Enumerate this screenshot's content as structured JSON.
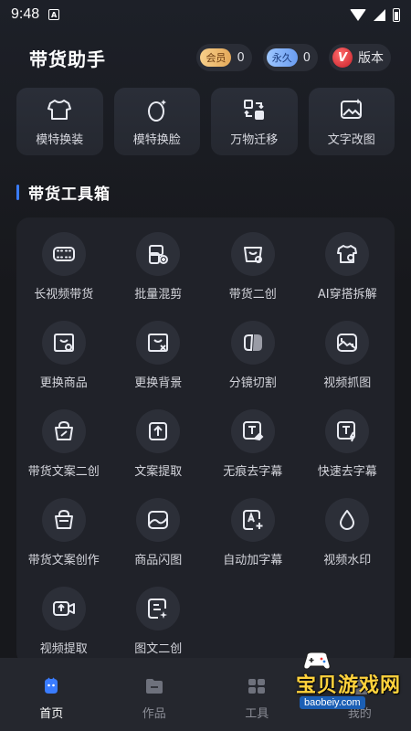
{
  "status_bar": {
    "time": "9:48",
    "notif_letter": "A"
  },
  "header": {
    "title": "带货助手",
    "vip_badge": "会员",
    "vip_count": "0",
    "forever_badge": "永久",
    "forever_count": "0",
    "version_badge": "V",
    "version_label": "版本"
  },
  "top_features": [
    {
      "label": "模特换装",
      "icon": "shirt-icon"
    },
    {
      "label": "模特换脸",
      "icon": "face-swap-icon"
    },
    {
      "label": "万物迁移",
      "icon": "transfer-icon"
    },
    {
      "label": "文字改图",
      "icon": "image-edit-icon"
    }
  ],
  "toolbox": {
    "title": "带货工具箱",
    "items": [
      {
        "label": "长视频带货",
        "icon": "film-strip-icon"
      },
      {
        "label": "批量混剪",
        "icon": "batch-clip-icon"
      },
      {
        "label": "带货二创",
        "icon": "shopping-bag-icon"
      },
      {
        "label": "AI穿搭拆解",
        "icon": "outfit-icon"
      },
      {
        "label": "更换商品",
        "icon": "swap-product-icon"
      },
      {
        "label": "更换背景",
        "icon": "background-icon"
      },
      {
        "label": "分镜切割",
        "icon": "scene-cut-icon"
      },
      {
        "label": "视频抓图",
        "icon": "video-capture-icon"
      },
      {
        "label": "带货文案二创",
        "icon": "copy-remix-icon"
      },
      {
        "label": "文案提取",
        "icon": "text-extract-icon"
      },
      {
        "label": "无痕去字幕",
        "icon": "subtitle-erase-icon"
      },
      {
        "label": "快速去字幕",
        "icon": "quick-subtitle-icon"
      },
      {
        "label": "带货文案创作",
        "icon": "copywrite-bag-icon"
      },
      {
        "label": "商品闪图",
        "icon": "flash-image-icon"
      },
      {
        "label": "自动加字幕",
        "icon": "add-subtitle-icon"
      },
      {
        "label": "视频水印",
        "icon": "watermark-drop-icon"
      },
      {
        "label": "视频提取",
        "icon": "video-extract-icon"
      },
      {
        "label": "图文二创",
        "icon": "image-text-icon"
      }
    ]
  },
  "bottom_nav": [
    {
      "label": "首页",
      "icon": "home-icon",
      "active": true
    },
    {
      "label": "作品",
      "icon": "folder-icon",
      "active": false
    },
    {
      "label": "工具",
      "icon": "tools-icon",
      "active": false
    },
    {
      "label": "我的",
      "icon": "profile-icon",
      "active": false
    }
  ],
  "watermark": {
    "text": "宝贝游戏网",
    "url": "baobeiy.com"
  },
  "colors": {
    "accent": "#3a7cff",
    "background": "#17181c",
    "panel": "#202229"
  }
}
